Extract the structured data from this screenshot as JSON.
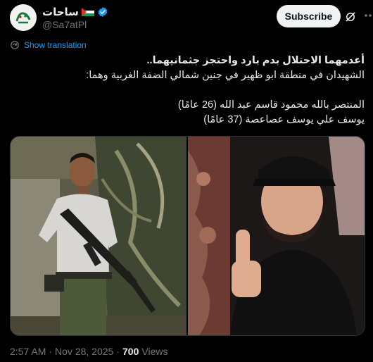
{
  "author": {
    "display_name": "ساحات",
    "handle": "@Sa7atPl",
    "verified": true,
    "avatar": "sahat-logo-avatar",
    "flag": "palestine-flag-icon"
  },
  "actions": {
    "subscribe_label": "Subscribe",
    "grok_icon": "grok-icon",
    "more_icon": "more-icon"
  },
  "translate": {
    "label": "Show translation",
    "icon": "translate-icon"
  },
  "tweet": {
    "headline": "أعدمهما الاحتلال بدم بارد واحتجز جثمانيهما..",
    "line2": "الشهيدان في منطقة ابو ظهير في جنين شمالي الضفة الغربية وهما:",
    "line3": "المنتصر بالله محمود قاسم عبد الله (26 عامًا)",
    "line4": "يوسف علي يوسف عصاعصة (37 عامًا)"
  },
  "media": {
    "photos": [
      {
        "name": "photo-armed-man",
        "description_icon": "photo"
      },
      {
        "name": "photo-man-black-cap",
        "description_icon": "photo"
      }
    ]
  },
  "footer": {
    "time": "2:57 AM",
    "separator": "·",
    "date": "Nov 28, 2025",
    "views_count": "700",
    "views_label": "Views"
  },
  "colors": {
    "background": "#000000",
    "text": "#e7e9ea",
    "secondary": "#71767b",
    "link": "#1d9bf0",
    "verified": "#1d9bf0"
  }
}
